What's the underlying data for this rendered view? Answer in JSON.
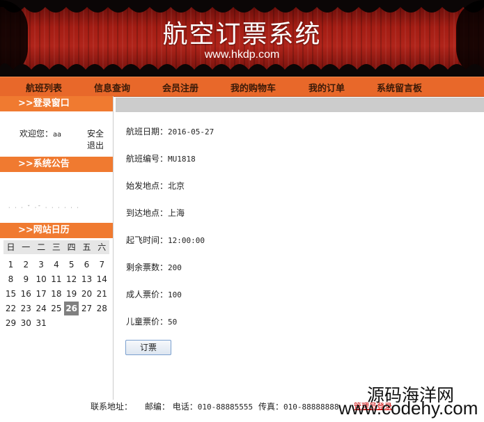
{
  "header": {
    "title": "航空订票系统",
    "url": "www.hkdp.com"
  },
  "nav": {
    "items": [
      "航班列表",
      "信息查询",
      "会员注册",
      "我的购物车",
      "我的订单",
      "系统留言板"
    ]
  },
  "sidebar": {
    "login_title": ">>登录窗口",
    "welcome_label": "欢迎您：",
    "username": "aa",
    "logout_label": "安全退出",
    "notice_title": ">>系统公告",
    "notice_dots": "· · ·   ˇ ·ˉ  · · · ·  · ·",
    "calendar_title": ">>网站日历",
    "calendar": {
      "weekdays": [
        "日",
        "一",
        "二",
        "三",
        "四",
        "五",
        "六"
      ],
      "weeks": [
        [
          "1",
          "2",
          "3",
          "4",
          "5",
          "6",
          "7"
        ],
        [
          "8",
          "9",
          "10",
          "11",
          "12",
          "13",
          "14"
        ],
        [
          "15",
          "16",
          "17",
          "18",
          "19",
          "20",
          "21"
        ],
        [
          "22",
          "23",
          "24",
          "25",
          "26",
          "27",
          "28"
        ],
        [
          "29",
          "30",
          "31",
          "",
          "",
          "",
          ""
        ]
      ],
      "today": "26"
    }
  },
  "flight": {
    "date_label": "航班日期：",
    "date": "2016-05-27",
    "number_label": "航班编号：",
    "number": "MU1818",
    "from_label": "始发地点：",
    "from": "北京",
    "to_label": "到达地点：",
    "to": "上海",
    "time_label": "起飞时间：",
    "time": "12:00:00",
    "tickets_label": "剩余票数：",
    "tickets": "200",
    "adult_label": "成人票价：",
    "adult_price": "100",
    "child_label": "儿童票价：",
    "child_price": "50",
    "book_button": "订票"
  },
  "footer": {
    "address_label": "联系地址：",
    "zip_label": "邮编：",
    "phone_label": "电话：",
    "phone": "010-88885555",
    "fax_label": "传真：",
    "fax": "010-88888888",
    "admin_login": "管理员登录"
  },
  "watermark": {
    "cn": "源码海洋网",
    "en": "www.codehy.com"
  }
}
